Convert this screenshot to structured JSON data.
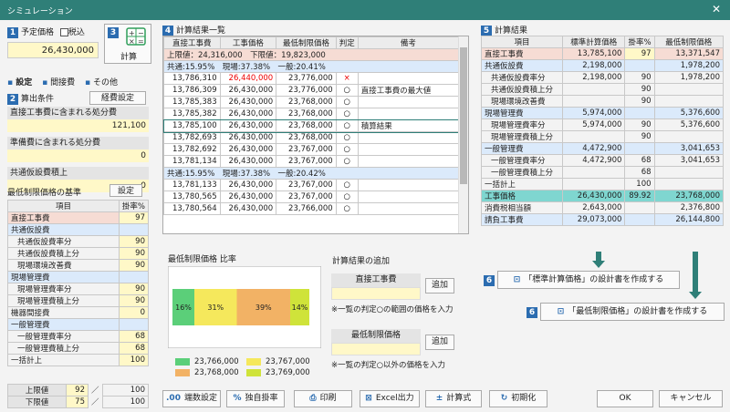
{
  "window": {
    "title": "シミュレーション",
    "close": "✕"
  },
  "colors": {
    "green": "#5bcf79",
    "yellow": "#f5e85c",
    "orange": "#f2b265",
    "lime": "#cfe33a",
    "accent": "#2b6cb0"
  },
  "left": {
    "sec1_num": "1",
    "planned_price_label": "予定価格",
    "tax_label": "税込",
    "planned_price_value": "26,430,000",
    "sec3_num": "3",
    "calc_label": "計算",
    "tabs": [
      "設定",
      "間接費",
      "その他"
    ],
    "sec2_num": "2",
    "calc_conditions": "算出条件",
    "cost_settings_btn": "経費設定",
    "field1_label": "直接工事費に含まれる処分費",
    "field1_value": "121,100",
    "field2_label": "準備費に含まれる処分費",
    "field2_value": "0",
    "field3_label": "共通仮設費積上",
    "field3_value": "0",
    "basis_label": "最低制限価格の基準",
    "settings_btn": "設定",
    "rate_header_item": "項目",
    "rate_header_rate": "掛率%",
    "rates": [
      {
        "name": "直接工事費",
        "rate": "97",
        "style": "pink",
        "ind": ""
      },
      {
        "name": "共通仮設費",
        "rate": "",
        "style": "blue",
        "ind": ""
      },
      {
        "name": "共通仮設費率分",
        "rate": "90",
        "style": "",
        "ind": "ind1"
      },
      {
        "name": "共通仮設費積上分",
        "rate": "90",
        "style": "",
        "ind": "ind1"
      },
      {
        "name": "現場環境改善費",
        "rate": "90",
        "style": "",
        "ind": "ind1"
      },
      {
        "name": "現場管理費",
        "rate": "",
        "style": "blue",
        "ind": ""
      },
      {
        "name": "現場管理費率分",
        "rate": "90",
        "style": "",
        "ind": "ind1"
      },
      {
        "name": "現場管理費積上分",
        "rate": "90",
        "style": "",
        "ind": "ind1"
      },
      {
        "name": "機器間接費",
        "rate": "0",
        "style": "",
        "ind": ""
      },
      {
        "name": "一般管理費",
        "rate": "",
        "style": "blue",
        "ind": ""
      },
      {
        "name": "一般管理費率分",
        "rate": "68",
        "style": "",
        "ind": "ind1"
      },
      {
        "name": "一般管理費積上分",
        "rate": "68",
        "style": "",
        "ind": "ind1"
      },
      {
        "name": "一括計上",
        "rate": "100",
        "style": "",
        "ind": ""
      }
    ],
    "upper_label": "上限値",
    "upper_value": "92",
    "upper_max": "100",
    "lower_label": "下限値",
    "lower_value": "75",
    "lower_max": "100",
    "slash": "／"
  },
  "mid": {
    "sec4_num": "4",
    "title": "計算結果一覧",
    "headers": [
      "直接工事費",
      "工事価格",
      "最低制限価格",
      "判定",
      "備考"
    ],
    "limit_row": "上限値：24,316,000　下限値：19,823,000",
    "group1": "共通:15.95%　現場:37.38%　一般:20.41%",
    "rows1": [
      {
        "a": "13,786,310",
        "b": "26,440,000",
        "c": "23,776,000",
        "j": "×",
        "n": "",
        "red": true
      },
      {
        "a": "13,786,309",
        "b": "26,430,000",
        "c": "23,776,000",
        "j": "○",
        "n": "直接工事費の最大値",
        "red": false
      },
      {
        "a": "13,785,383",
        "b": "26,430,000",
        "c": "23,768,000",
        "j": "○",
        "n": "",
        "red": false
      },
      {
        "a": "13,785,382",
        "b": "26,430,000",
        "c": "23,768,000",
        "j": "○",
        "n": "",
        "red": false
      },
      {
        "a": "13,785,100",
        "b": "26,430,000",
        "c": "23,768,000",
        "j": "○",
        "n": "積算結果",
        "red": false,
        "sel": true
      },
      {
        "a": "13,782,693",
        "b": "26,430,000",
        "c": "23,768,000",
        "j": "○",
        "n": "",
        "red": false
      },
      {
        "a": "13,782,692",
        "b": "26,430,000",
        "c": "23,767,000",
        "j": "○",
        "n": "",
        "red": false
      },
      {
        "a": "13,781,134",
        "b": "26,430,000",
        "c": "23,767,000",
        "j": "○",
        "n": "",
        "red": false
      }
    ],
    "group2": "共通:15.95%　現場:37.38%　一般:20.42%",
    "rows2": [
      {
        "a": "13,781,133",
        "b": "26,430,000",
        "c": "23,767,000",
        "j": "○",
        "n": ""
      },
      {
        "a": "13,780,565",
        "b": "26,430,000",
        "c": "23,767,000",
        "j": "○",
        "n": ""
      },
      {
        "a": "13,780,564",
        "b": "26,430,000",
        "c": "23,766,000",
        "j": "○",
        "n": ""
      }
    ],
    "ratio_title": "最低制限価格 比率",
    "add_title": "計算結果の追加",
    "add1_label": "直接工事費",
    "add_btn": "追加",
    "add1_note": "※一覧の判定○の範囲の価格を入力",
    "add2_label": "最低制限価格",
    "add2_note": "※一覧の判定○以外の価格を入力"
  },
  "chart_data": {
    "type": "bar",
    "title": "最低制限価格 比率",
    "series": [
      {
        "name": "23,766,000",
        "values": [
          16
        ]
      },
      {
        "name": "23,767,000",
        "values": [
          31
        ]
      },
      {
        "name": "23,768,000",
        "values": [
          39
        ]
      },
      {
        "name": "23,769,000",
        "values": [
          14
        ]
      }
    ],
    "labels": [
      "16%",
      "31%",
      "39%",
      "14%"
    ],
    "legend": "bottom"
  },
  "right": {
    "sec5_num": "5",
    "title": "計算結果",
    "headers": [
      "項目",
      "標準計算価格",
      "掛率%",
      "最低制限価格"
    ],
    "rows": [
      {
        "n": "直接工事費",
        "s": "13,785,100",
        "r": "97",
        "m": "13,371,547",
        "st": "pink",
        "ind": ""
      },
      {
        "n": "共通仮設費",
        "s": "2,198,000",
        "r": "",
        "m": "1,978,200",
        "st": "blue",
        "ind": ""
      },
      {
        "n": "共通仮設費率分",
        "s": "2,198,000",
        "r": "90",
        "m": "1,978,200",
        "st": "",
        "ind": "ind1"
      },
      {
        "n": "共通仮設費積上分",
        "s": "",
        "r": "90",
        "m": "",
        "st": "",
        "ind": "ind1"
      },
      {
        "n": "現場環境改善費",
        "s": "",
        "r": "90",
        "m": "",
        "st": "",
        "ind": "ind1"
      },
      {
        "n": "現場管理費",
        "s": "5,974,000",
        "r": "",
        "m": "5,376,600",
        "st": "blue",
        "ind": ""
      },
      {
        "n": "現場管理費率分",
        "s": "5,974,000",
        "r": "90",
        "m": "5,376,600",
        "st": "",
        "ind": "ind1"
      },
      {
        "n": "現場管理費積上分",
        "s": "",
        "r": "90",
        "m": "",
        "st": "",
        "ind": "ind1"
      },
      {
        "n": "一般管理費",
        "s": "4,472,900",
        "r": "",
        "m": "3,041,653",
        "st": "blue",
        "ind": ""
      },
      {
        "n": "一般管理費率分",
        "s": "4,472,900",
        "r": "68",
        "m": "3,041,653",
        "st": "",
        "ind": "ind1"
      },
      {
        "n": "一般管理費積上分",
        "s": "",
        "r": "68",
        "m": "",
        "st": "",
        "ind": "ind1"
      },
      {
        "n": "一括計上",
        "s": "",
        "r": "100",
        "m": "",
        "st": "",
        "ind": ""
      },
      {
        "n": "工事価格",
        "s": "26,430,000",
        "r": "89.92",
        "m": "23,768,000",
        "st": "teal",
        "ind": ""
      },
      {
        "n": "消費税相当額",
        "s": "2,643,000",
        "r": "",
        "m": "2,376,800",
        "st": "",
        "ind": ""
      },
      {
        "n": "請負工事費",
        "s": "29,073,000",
        "r": "",
        "m": "26,144,800",
        "st": "blue",
        "ind": ""
      }
    ],
    "sec6_num": "6",
    "make_std": "「標準計算価格」の設計書を作成する",
    "make_min": "「最低制限価格」の設計書を作成する"
  },
  "bottom": {
    "decimals": "端数設定",
    "own_rate": "独自掛率",
    "print": "印刷",
    "excel": "Excel出力",
    "formula": "計算式",
    "init": "初期化",
    "ok": "OK",
    "cancel": "キャンセル"
  }
}
